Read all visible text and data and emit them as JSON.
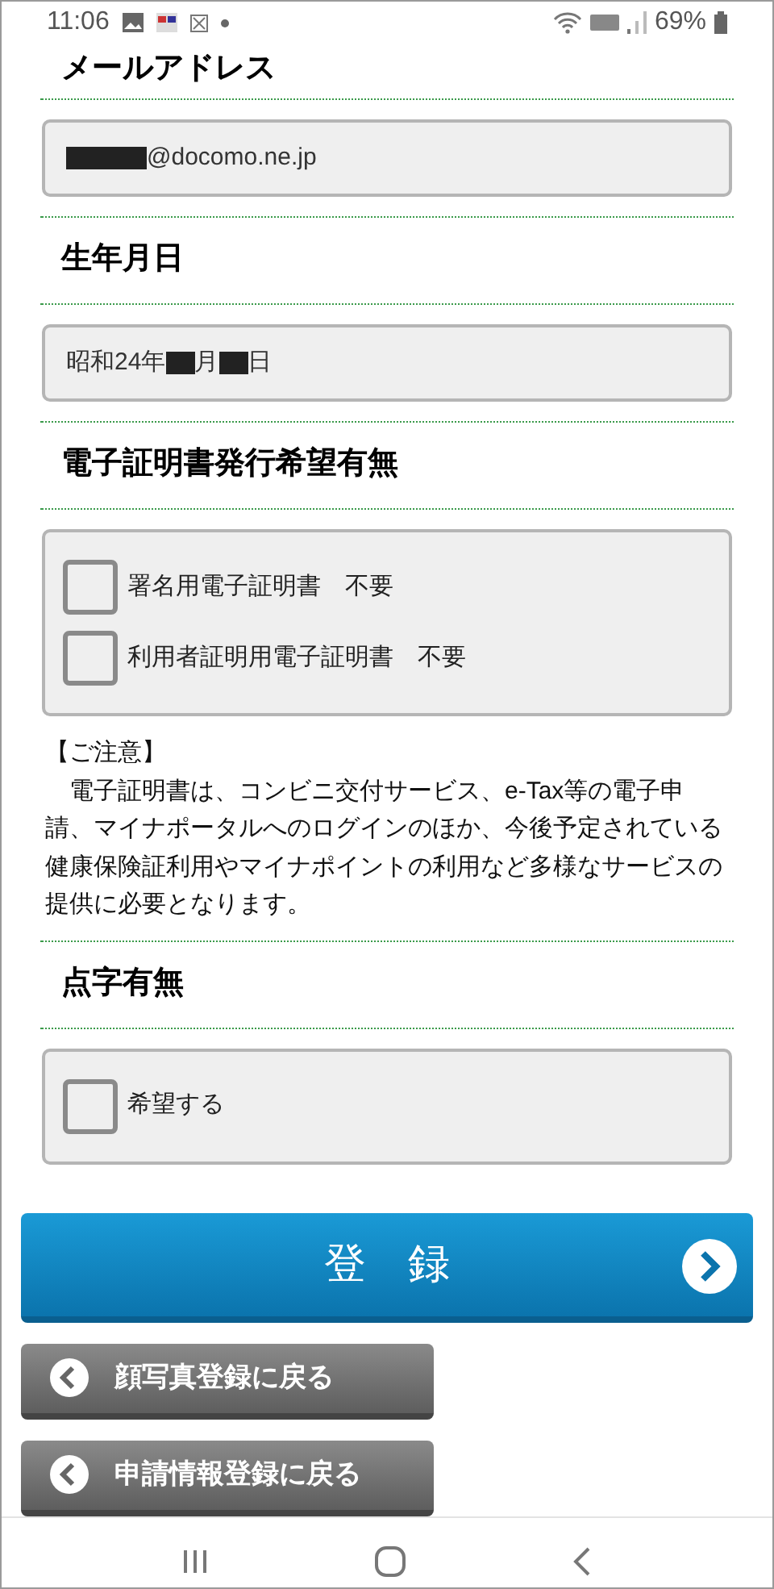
{
  "status_bar": {
    "time": "11:06",
    "battery": "69%"
  },
  "sections": [
    {
      "heading": "メールアドレス",
      "kind": "field",
      "value": [
        {
          "kind": "redacted"
        },
        {
          "kind": "text",
          "text": "@docomo.ne.jp"
        }
      ]
    },
    {
      "heading": "生年月日",
      "kind": "field",
      "value": [
        {
          "kind": "text",
          "text": "昭和24年"
        },
        {
          "kind": "redacted"
        },
        {
          "kind": "text",
          "text": "月"
        },
        {
          "kind": "redacted"
        },
        {
          "kind": "text",
          "text": "日"
        }
      ]
    },
    {
      "heading": "電子証明書発行希望有無",
      "kind": "checkboxes",
      "options": [
        {
          "label": "署名用電子証明書　不要",
          "checked": false
        },
        {
          "label": "利用者証明用電子証明書　不要",
          "checked": false
        }
      ],
      "notice": {
        "title": "【ご注意】",
        "body": "　電子証明書は、コンビニ交付サービス、e-Tax等の電子申請、マイナポータルへのログインのほか、今後予定されている健康保険証利用やマイナポイントの利用など多様なサービスの提供に必要となります。"
      }
    },
    {
      "heading": "点字有無",
      "kind": "checkboxes",
      "options": [
        {
          "label": "希望する",
          "checked": false
        }
      ]
    }
  ],
  "register_button": "登　録",
  "back_buttons": [
    "顔写真登録に戻る",
    "申請情報登録に戻る"
  ]
}
